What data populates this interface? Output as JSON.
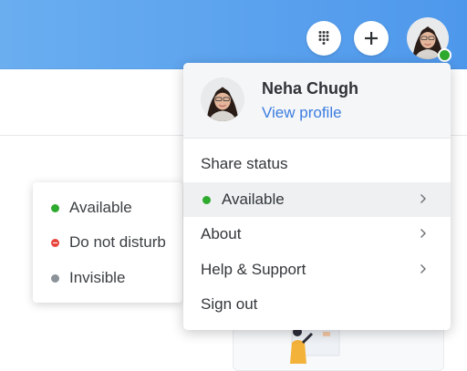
{
  "profile_menu": {
    "user_name": "Neha Chugh",
    "view_profile_label": "View profile",
    "share_status_label": "Share status",
    "current_status_label": "Available",
    "about_label": "About",
    "help_label": "Help & Support",
    "signout_label": "Sign out"
  },
  "status_options": [
    {
      "label": "Available",
      "color": "#2eaa2e"
    },
    {
      "label": "Do not disturb",
      "color": "#e8453c"
    },
    {
      "label": "Invisible",
      "color": "#8c9299"
    }
  ],
  "colors": {
    "accent": "#3b7de0",
    "header_bar": "#5aa2ee",
    "presence_online": "#2eaa2e"
  },
  "icons": {
    "dialpad": "dialpad-icon",
    "add": "plus-icon",
    "submenu": "chevron-right-icon"
  }
}
